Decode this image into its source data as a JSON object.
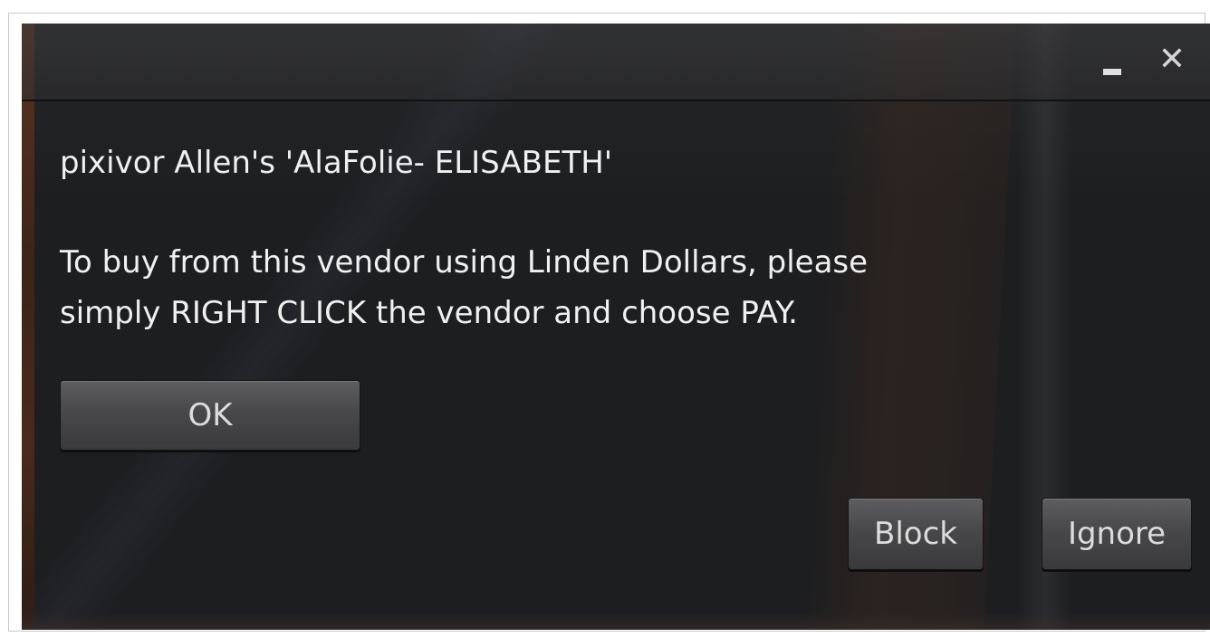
{
  "window": {
    "minimize_label": "",
    "close_label": "✕"
  },
  "message": {
    "title_line": "pixivor Allen's 'AlaFolie- ELISABETH'",
    "body": "To buy from this vendor using Linden Dollars, please\nsimply RIGHT CLICK the vendor and choose PAY."
  },
  "buttons": {
    "ok": "OK",
    "block": "Block",
    "ignore": "Ignore"
  },
  "colors": {
    "dialog_background": "#1b1c1e",
    "text": "#f0f0f0",
    "button_face": "#48484a"
  }
}
